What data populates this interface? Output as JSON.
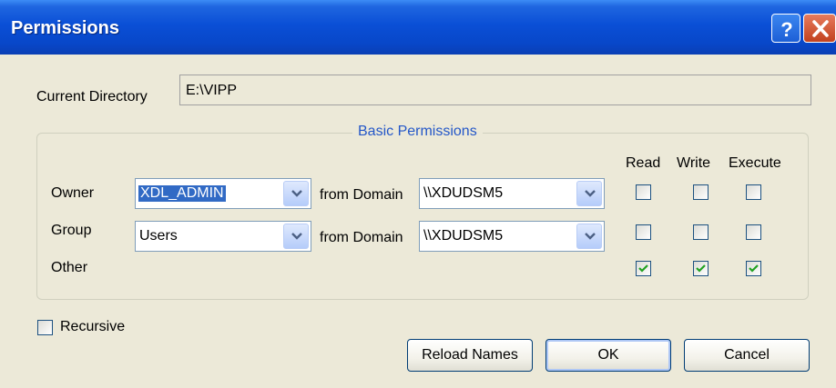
{
  "window": {
    "title": "Permissions"
  },
  "current_directory": {
    "label": "Current Directory",
    "value": "E:\\VIPP"
  },
  "basic_permissions": {
    "title": "Basic Permissions",
    "columns": [
      "Read",
      "Write",
      "Execute"
    ],
    "from_domain_label": "from Domain",
    "rows": [
      {
        "label": "Owner",
        "name": "XDL_ADMIN",
        "domain": "\\\\XDUDSM5",
        "read": false,
        "write": false,
        "execute": false
      },
      {
        "label": "Group",
        "name": "Users",
        "domain": "\\\\XDUDSM5",
        "read": false,
        "write": false,
        "execute": false
      },
      {
        "label": "Other",
        "read": true,
        "write": true,
        "execute": true
      }
    ]
  },
  "recursive": {
    "label": "Recursive",
    "checked": false
  },
  "buttons": {
    "reload": "Reload Names",
    "ok": "OK",
    "cancel": "Cancel"
  }
}
